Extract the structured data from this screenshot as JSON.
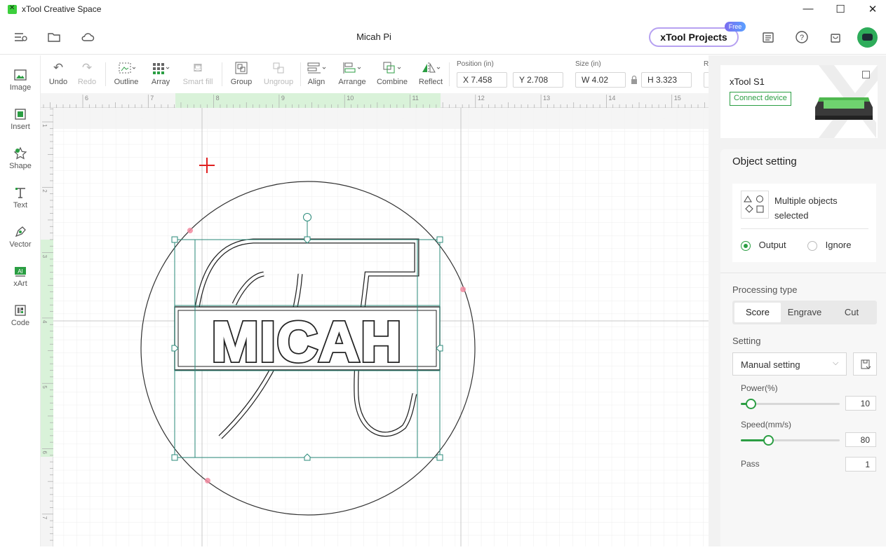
{
  "window": {
    "app_title": "xTool Creative Space",
    "minimize_glyph": "—",
    "maximize_glyph": "☐",
    "close_glyph": "✕"
  },
  "header": {
    "doc_title": "Micah Pi",
    "projects_label": "xTool Projects",
    "free_badge": "Free"
  },
  "left_tools": [
    {
      "label": "Image",
      "icon": "image-icon"
    },
    {
      "label": "Insert",
      "icon": "insert-icon"
    },
    {
      "label": "Shape",
      "icon": "shape-icon"
    },
    {
      "label": "Text",
      "icon": "text-icon"
    },
    {
      "label": "Vector",
      "icon": "pen-icon"
    },
    {
      "label": "xArt",
      "icon": "ai-icon"
    },
    {
      "label": "Code",
      "icon": "qr-code-icon"
    }
  ],
  "toolbar": {
    "undo": "Undo",
    "redo": "Redo",
    "outline": "Outline",
    "array": "Array",
    "smart_fill": "Smart fill",
    "group": "Group",
    "ungroup": "Ungroup",
    "align": "Align",
    "arrange": "Arrange",
    "combine": "Combine",
    "reflect": "Reflect",
    "position_label": "Position (in)",
    "x_value": "X 7.458",
    "y_value": "Y 2.708",
    "size_label": "Size (in)",
    "w_value": "W 4.02",
    "h_value": "H 3.323",
    "rotate_label_partial": "R"
  },
  "ruler": {
    "top_ticks": [
      "6",
      "7",
      "8",
      "9",
      "10",
      "11",
      "12",
      "13",
      "14",
      "15"
    ],
    "left_ticks": [
      "1",
      "2",
      "3",
      "4",
      "5",
      "6",
      "7"
    ]
  },
  "canvas": {
    "design_text": "MICAH"
  },
  "device": {
    "name": "xTool S1",
    "connect_label": "Connect device"
  },
  "object_setting": {
    "title": "Object setting",
    "selection_text_line1": "Multiple objects",
    "selection_text_line2": "selected",
    "output_label": "Output",
    "ignore_label": "Ignore",
    "output_selected": true,
    "processing_type_label": "Processing type",
    "processing_types": [
      "Score",
      "Engrave",
      "Cut"
    ],
    "active_processing_type": "Score",
    "setting_label": "Setting",
    "setting_value": "Manual setting",
    "power_label": "Power(%)",
    "power_value": "10",
    "power_level_percent": 10,
    "speed_label": "Speed(mm/s)",
    "speed_value": "80",
    "speed_level_fraction": 0.28,
    "pass_label": "Pass",
    "pass_value": "1"
  },
  "colors": {
    "accent": "#2b9e43",
    "selection_box": "#2a8a7a",
    "cursor_cross": "#e02020"
  }
}
